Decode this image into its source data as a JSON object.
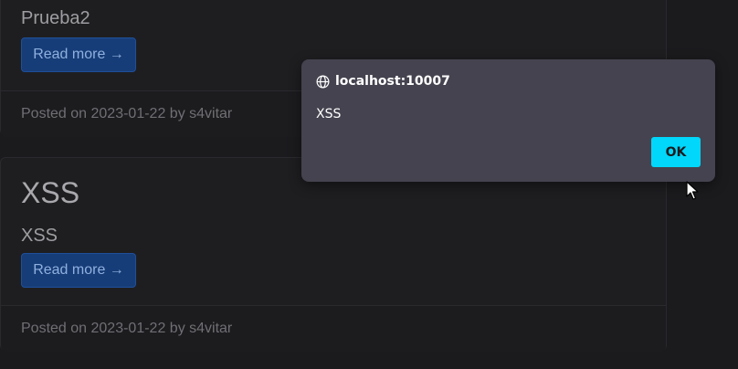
{
  "posts": [
    {
      "title": "",
      "subtitle": "Prueba2",
      "read_more_label": "Read more →",
      "footer": "Posted on 2023-01-22 by s4vitar"
    },
    {
      "title": "XSS",
      "subtitle": "XSS",
      "read_more_label": "Read more →",
      "footer": "Posted on 2023-01-22 by s4vitar"
    }
  ],
  "alert": {
    "origin": "localhost:10007",
    "message": "XSS",
    "ok_label": "OK",
    "origin_icon": "globe-icon"
  },
  "colors": {
    "ok_button": "#00d7fb",
    "dialog_bg": "#45434f",
    "read_more_bg": "#173d78"
  }
}
